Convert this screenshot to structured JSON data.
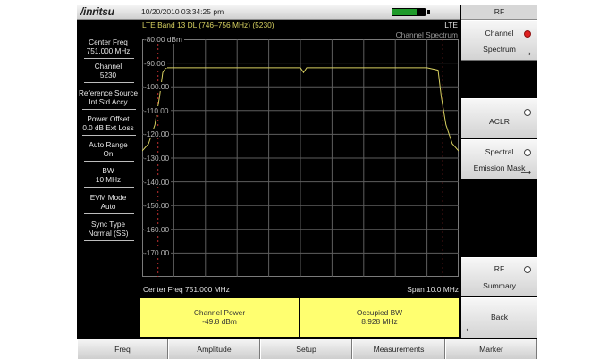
{
  "instrument": {
    "logo": "/inritsu",
    "datetime": "10/20/2010 03:34:25 pm",
    "battery_level": 0.75,
    "battery_color": "#1f9a2a"
  },
  "parameters": [
    {
      "name": "Center Freq",
      "value": "751.000 MHz"
    },
    {
      "name": "Channel",
      "value": "5230"
    },
    {
      "name": "Reference Source",
      "value": "Int Std Accy"
    },
    {
      "name": "Power Offset",
      "value": "0.0 dB Ext Loss"
    },
    {
      "name": "Auto Range",
      "value": "On"
    },
    {
      "name": "BW",
      "value": "10 MHz"
    },
    {
      "name": "EVM Mode",
      "value": "Auto"
    },
    {
      "name": "Sync Type",
      "value": "Normal (SS)"
    }
  ],
  "graph": {
    "band_label": "LTE Band 13 DL (746–756 MHz) (5230)",
    "mode": "LTE",
    "measurement": "Channel Spectrum",
    "unit": "dBm",
    "center_label": "Center Freq 751.000 MHz",
    "span_label": "Span 10.0 MHz",
    "trace_color": "#d8d060"
  },
  "chart_data": {
    "type": "line",
    "title": "",
    "xlabel": "Center Freq 751.000 MHz",
    "ylabel": "",
    "x_unit": "MHz",
    "xlim": [
      746.0,
      756.0
    ],
    "ylim": [
      -180,
      -80
    ],
    "y_ticks": [
      "-80.00 dBm",
      "-90.00",
      "-100.00",
      "-110.00",
      "-120.00",
      "-130.00",
      "-140.00",
      "-150.00",
      "-160.00",
      "-170.00"
    ],
    "grid": true,
    "series": [
      {
        "values": [
          {
            "x": 746.0,
            "y": -127
          },
          {
            "x": 746.2,
            "y": -124
          },
          {
            "x": 746.4,
            "y": -116
          },
          {
            "x": 746.55,
            "y": -104
          },
          {
            "x": 746.65,
            "y": -94
          },
          {
            "x": 746.75,
            "y": -92
          },
          {
            "x": 748.0,
            "y": -92
          },
          {
            "x": 749.0,
            "y": -92
          },
          {
            "x": 750.0,
            "y": -92
          },
          {
            "x": 751.0,
            "y": -92
          },
          {
            "x": 751.1,
            "y": -94
          },
          {
            "x": 751.2,
            "y": -92
          },
          {
            "x": 752.0,
            "y": -92
          },
          {
            "x": 753.0,
            "y": -92
          },
          {
            "x": 754.0,
            "y": -92
          },
          {
            "x": 755.0,
            "y": -92
          },
          {
            "x": 755.35,
            "y": -93
          },
          {
            "x": 755.45,
            "y": -104
          },
          {
            "x": 755.6,
            "y": -116
          },
          {
            "x": 755.8,
            "y": -124
          },
          {
            "x": 756.0,
            "y": -127
          }
        ]
      }
    ]
  },
  "results": [
    {
      "label": "Channel Power",
      "value": "-49.8 dBm"
    },
    {
      "label": "Occupied BW",
      "value": "8.928 MHz"
    }
  ],
  "right_panel": {
    "title": "RF",
    "softkeys": [
      {
        "label": "Channel",
        "label2": "Spectrum",
        "selected": true
      },
      {
        "label": "ACLR",
        "label2": "",
        "selected": false
      },
      {
        "label": "Spectral",
        "label2": "Emission Mask",
        "selected": false
      },
      {
        "label": "RF",
        "label2": "Summary",
        "selected": false
      },
      {
        "label": "Back",
        "label2": "",
        "selected": false
      }
    ]
  },
  "bottom_tabs": [
    "Freq",
    "Amplitude",
    "Setup",
    "Measurements",
    "Marker"
  ]
}
